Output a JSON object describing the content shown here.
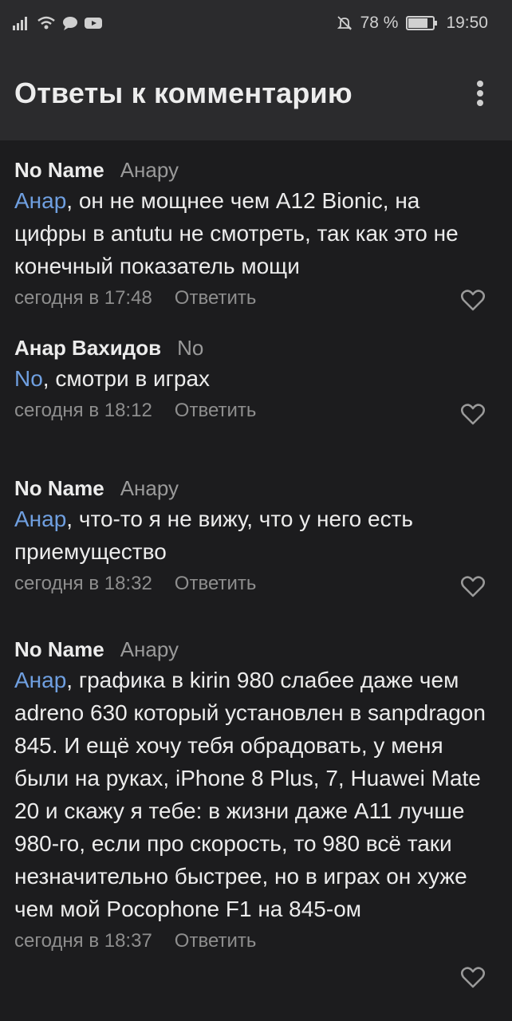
{
  "status_bar": {
    "battery": "78 %",
    "time": "19:50"
  },
  "app_bar": {
    "title": "Ответы к комментарию"
  },
  "comments": [
    {
      "author": "No Name",
      "reply_to": "Анару",
      "mention": "Анар",
      "text": ", он не мощнее чем А12 Bionic,  на цифры в antutu не смотреть, так как это не конечный показатель мощи",
      "time": "сегодня в 17:48",
      "reply_label": "Ответить"
    },
    {
      "author": "Анар Вахидов",
      "reply_to": "No",
      "mention": "No",
      "text": ", смотри в играх",
      "time": "сегодня в 18:12",
      "reply_label": "Ответить"
    },
    {
      "author": "No Name",
      "reply_to": "Анару",
      "mention": "Анар",
      "text": ", что-то я не вижу, что у него есть приемущество",
      "time": "сегодня в 18:32",
      "reply_label": "Ответить"
    },
    {
      "author": "No Name",
      "reply_to": "Анару",
      "mention": "Анар",
      "text": ", графика в kirin 980 слабее даже чем adreno 630 который установлен в sanpdragon 845. И ещё хочу тебя обрадовать, у меня были на руках, iPhone 8 Plus, 7, Huawei Mate 20 и скажу я тебе: в жизни даже А11 лучше 980-го, если про скорость, то 980 всё таки незначительно быстрее, но в играх он хуже чем мой Pocophone F1 на 845-ом",
      "time": "сегодня в 18:37",
      "reply_label": "Ответить"
    }
  ],
  "colors": {
    "background": "#1c1c1e",
    "bar": "#2b2b2d",
    "mention": "#6f9fe0",
    "muted": "#8e8e8e"
  }
}
